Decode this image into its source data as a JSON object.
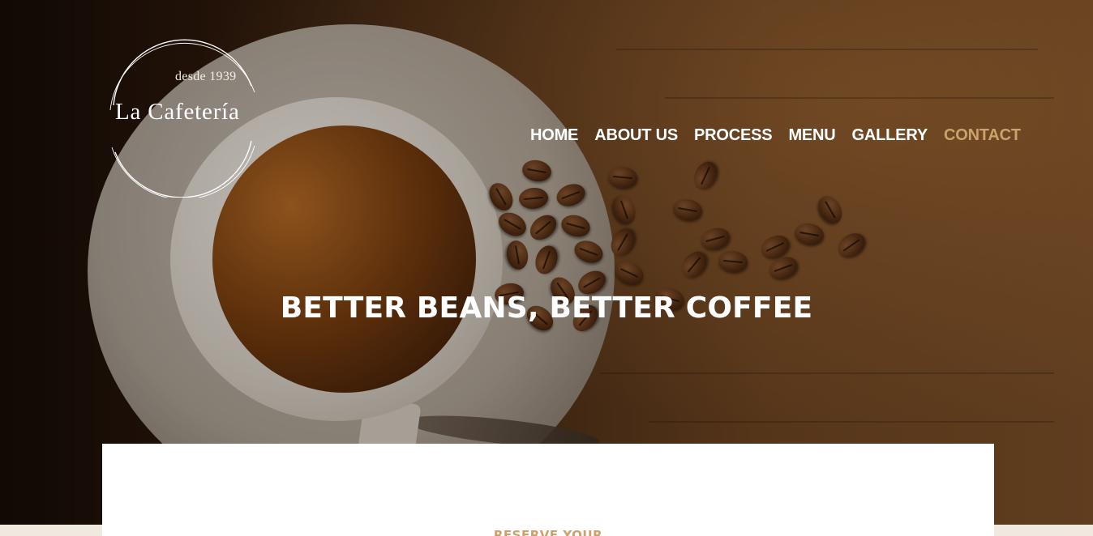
{
  "brand": {
    "since": "desde 1939",
    "name": "La Cafetería"
  },
  "nav": {
    "items": [
      {
        "label": "HOME",
        "active": false
      },
      {
        "label": "ABOUT US",
        "active": false
      },
      {
        "label": "PROCESS",
        "active": false
      },
      {
        "label": "MENU",
        "active": false
      },
      {
        "label": "GALLERY",
        "active": false
      },
      {
        "label": "CONTACT",
        "active": true
      }
    ]
  },
  "hero": {
    "headline": "BETTER BEANS, BETTER COFFEE"
  },
  "reservation": {
    "title": "RESERVE YOUR"
  },
  "colors": {
    "accent": "#c9a26d",
    "text_light": "#ffffff",
    "page_background": "#efe9df"
  }
}
